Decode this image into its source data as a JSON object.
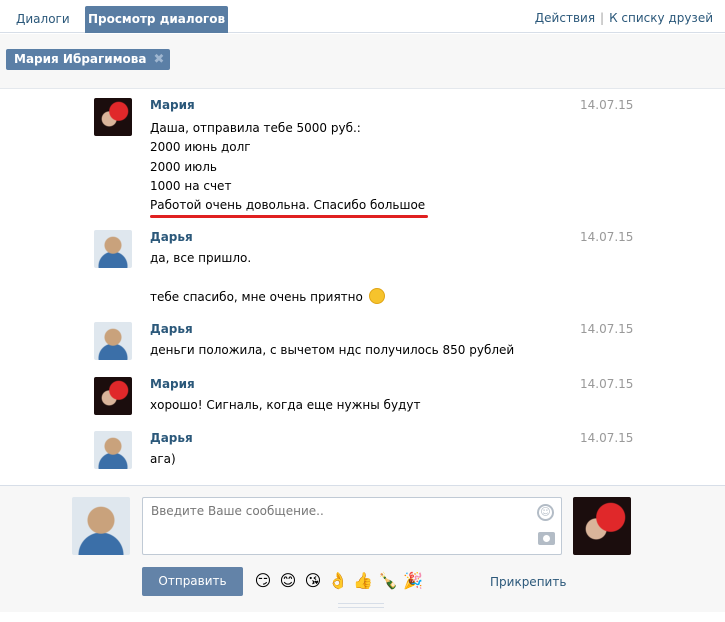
{
  "tabs": {
    "dialogs": "Диалоги",
    "view_dialogs": "Просмотр диалогов"
  },
  "top_links": {
    "actions": "Действия",
    "separator": "|",
    "to_friends": "К списку друзей"
  },
  "filter_chip": {
    "label": "Мария Ибрагимова",
    "close_icon": "close-icon"
  },
  "messages": [
    {
      "author": "Мария",
      "date": "14.07.15",
      "avatar": "avatar-maria",
      "lines": [
        "Даша, отправила тебе 5000 руб.:",
        "2000 июнь долг",
        "2000 июль",
        "1000 на счет",
        "Работой очень довольна. Спасибо большое"
      ]
    },
    {
      "author": "Дарья",
      "date": "14.07.15",
      "avatar": "avatar-darya",
      "lines": [
        "да, все пришло.",
        "тебе спасибо, мне очень приятно"
      ]
    },
    {
      "author": "Дарья",
      "date": "14.07.15",
      "avatar": "avatar-darya",
      "lines": [
        "деньги положила, с вычетом ндс получилось 850 рублей"
      ]
    },
    {
      "author": "Мария",
      "date": "14.07.15",
      "avatar": "avatar-maria",
      "lines": [
        "хорошо! Сигналь, когда еще нужны будут"
      ]
    },
    {
      "author": "Дарья",
      "date": "14.07.15",
      "avatar": "avatar-darya",
      "lines": [
        "ага)"
      ]
    }
  ],
  "composer": {
    "placeholder": "Введите Ваше сообщение..",
    "send_label": "Отправить",
    "attach_label": "Прикрепить",
    "quick_emojis": [
      "😏",
      "😊",
      "😘",
      "👌",
      "👍",
      "🍾",
      "🎉"
    ]
  },
  "colors": {
    "accent": "#597da3",
    "link": "#2b587a",
    "underline": "#e02020"
  }
}
